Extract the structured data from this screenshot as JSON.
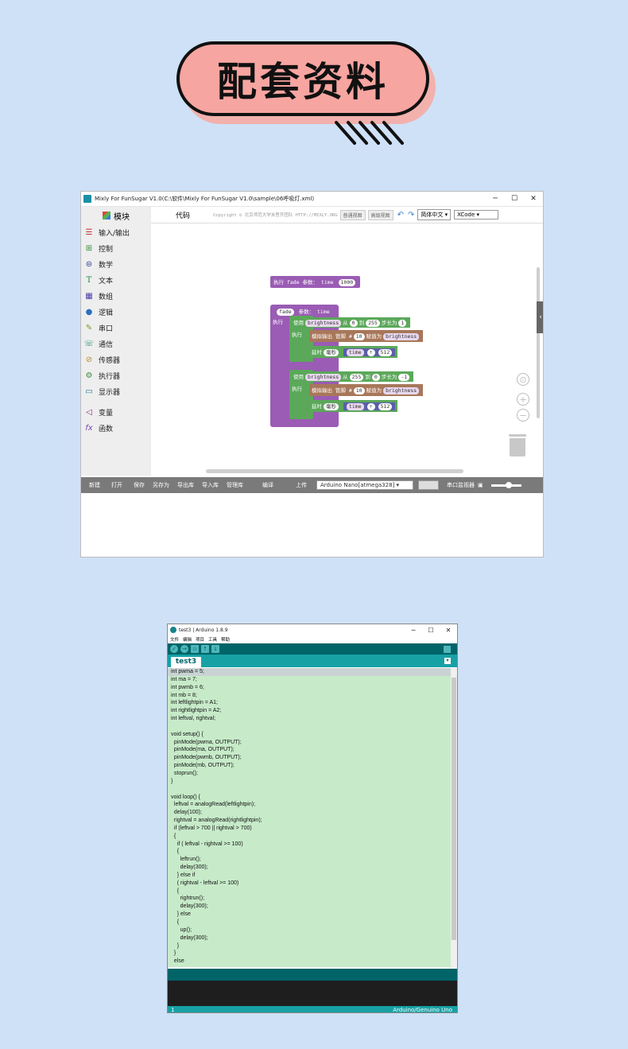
{
  "banner": {
    "title": "配套资料"
  },
  "mixly": {
    "window_title": "Mixly For FunSugar V1.0(C:\\软件\\Mixly For FunSugar V1.0\\sample\\06呼吸灯.xml)",
    "sidebar_title": "模块",
    "categories": [
      "输入/输出",
      "控制",
      "数学",
      "文本",
      "数组",
      "逻辑",
      "串口",
      "通信",
      "传感器",
      "执行器",
      "显示器",
      "变量",
      "函数"
    ],
    "code_tab": "代码",
    "copyright": "Copyright © 北京师范大学米思齐团队 HTTP://MIXLY.ORG",
    "btn_normal": "普通视图",
    "btn_advanced": "高级视图",
    "language": "简体中文",
    "theme": "XCode",
    "blocks": {
      "call_exec": "执行",
      "call_name": "fade",
      "call_param": "参数：",
      "call_time": "time",
      "call_value": "1000",
      "def_name": "fade",
      "def_param": "参数：",
      "def_time": "time",
      "exec": "执行",
      "use": "使用",
      "var": "brightness",
      "from": "从",
      "to": "到",
      "step": "步长为",
      "loop1_from": "0",
      "loop1_to": "255",
      "loop1_step": "1",
      "loop2_from": "255",
      "loop2_to": "0",
      "loop2_step": "-1",
      "analog_out": "模拟输出 管脚 #",
      "pin": "10",
      "assign": "赋值为",
      "delay": "延时",
      "ms": "毫秒",
      "time": "time",
      "op": "÷",
      "divisor": "512"
    },
    "bottom": {
      "new": "新建",
      "open": "打开",
      "save": "保存",
      "save_as": "另存为",
      "export_lib": "导出库",
      "import_lib": "导入库",
      "manage_lib": "管理库",
      "compile": "编译",
      "upload": "上传",
      "board": "Arduino Nano[atmega328]",
      "serial_monitor": "串口监视器"
    }
  },
  "arduino": {
    "window_title": "test3 | Arduino 1.8.9",
    "menu": [
      "文件",
      "编辑",
      "项目",
      "工具",
      "帮助"
    ],
    "tab": "test3",
    "code_lines": [
      "int pwma = 5;",
      "int ma = 7;",
      "int pwmb = 6;",
      "int mb = 8;",
      "int leftlightpin = A1;",
      "int rightlightpin = A2;",
      "int leftval, rightval;",
      "",
      "void setup() {",
      "  pinMode(pwma, OUTPUT);",
      "  pinMode(ma, OUTPUT);",
      "  pinMode(pwmb, OUTPUT);",
      "  pinMode(mb, OUTPUT);",
      "  stoprun();",
      "}",
      "",
      "void loop() {",
      "  leftval = analogRead(leftlightpin);",
      "  delay(100);",
      "  rightval = analogRead(rightlightpin);",
      "  if (leftval > 700 || rightval > 700)",
      "  {",
      "    if ( leftval - rightval >= 100)",
      "    {",
      "      leftrun();",
      "      delay(300);",
      "    } else if",
      "    ( rightval - leftval >= 100)",
      "    {",
      "      rightrun();",
      "      delay(300);",
      "    } else",
      "    {",
      "      up();",
      "      delay(300);",
      "    }",
      "  }",
      "  else"
    ],
    "status_line": "1",
    "status_board": "Arduino/Genuino Uno"
  }
}
